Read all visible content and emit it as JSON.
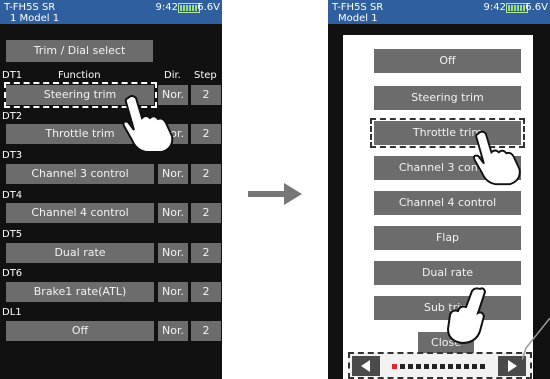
{
  "left_screen": {
    "header": {
      "model_line1": "T-FH5S SR",
      "time": "9:42",
      "voltage": "6.6V",
      "model_line2": "1 Model 1"
    },
    "title_button": "Trim / Dial select",
    "columns": {
      "function": "Function",
      "dir": "Dir.",
      "step": "Step"
    },
    "rows": [
      {
        "id": "DT1",
        "function": "Steering trim",
        "dir": "Nor.",
        "step": "2"
      },
      {
        "id": "DT2",
        "function": "Throttle trim",
        "dir": "Nor.",
        "step": "2"
      },
      {
        "id": "DT3",
        "function": "Channel 3 control",
        "dir": "Nor.",
        "step": "2"
      },
      {
        "id": "DT4",
        "function": "Channel 4 control",
        "dir": "Nor.",
        "step": "2"
      },
      {
        "id": "DT5",
        "function": "Dual rate",
        "dir": "Nor.",
        "step": "2"
      },
      {
        "id": "DT6",
        "function": "Brake1 rate(ATL)",
        "dir": "Nor.",
        "step": "2"
      },
      {
        "id": "DL1",
        "function": "Off",
        "dir": "Nor.",
        "step": "2"
      }
    ]
  },
  "right_screen": {
    "header": {
      "model_line1": "T-FH5S SR",
      "time": "9:42",
      "voltage": "6.6V",
      "model_line2": "Model 1"
    },
    "options": [
      "Off",
      "Steering trim",
      "Throttle trim",
      "Channel 3 control",
      "Channel 4 control",
      "Flap",
      "Dual rate",
      "Sub trim"
    ],
    "close_label": "Close",
    "prev_icon": "left-triangle-icon",
    "next_icon": "right-triangle-icon"
  },
  "arrow_icon": "right-arrow-icon",
  "colors": {
    "header": "#2f5f9e",
    "button": "#6c6c6c",
    "screen": "#111111",
    "popup": "#ffffff"
  }
}
